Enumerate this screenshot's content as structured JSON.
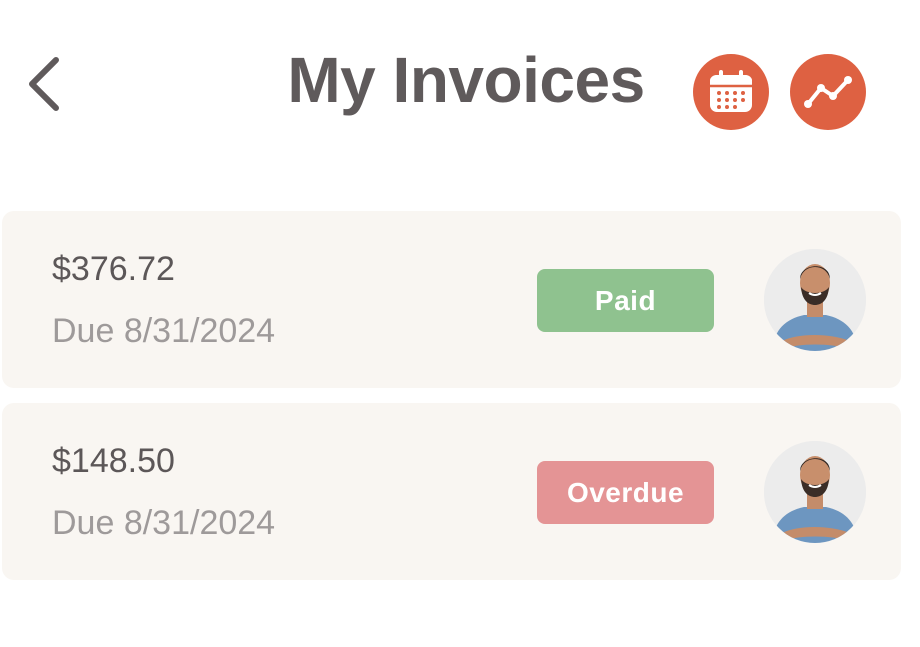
{
  "header": {
    "title": "My Invoices",
    "back_icon": "chevron-left-icon",
    "actions": [
      {
        "icon": "calendar-icon"
      },
      {
        "icon": "trend-line-icon"
      }
    ]
  },
  "colors": {
    "accent": "#de6142",
    "paid": "#8fc28f",
    "overdue": "#e49495",
    "card_bg": "#f9f6f2",
    "title": "#5f5a5b"
  },
  "invoices": [
    {
      "amount": "$376.72",
      "due": "Due 8/31/2024",
      "status": "Paid"
    },
    {
      "amount": "$148.50",
      "due": "Due 8/31/2024",
      "status": "Overdue"
    }
  ]
}
